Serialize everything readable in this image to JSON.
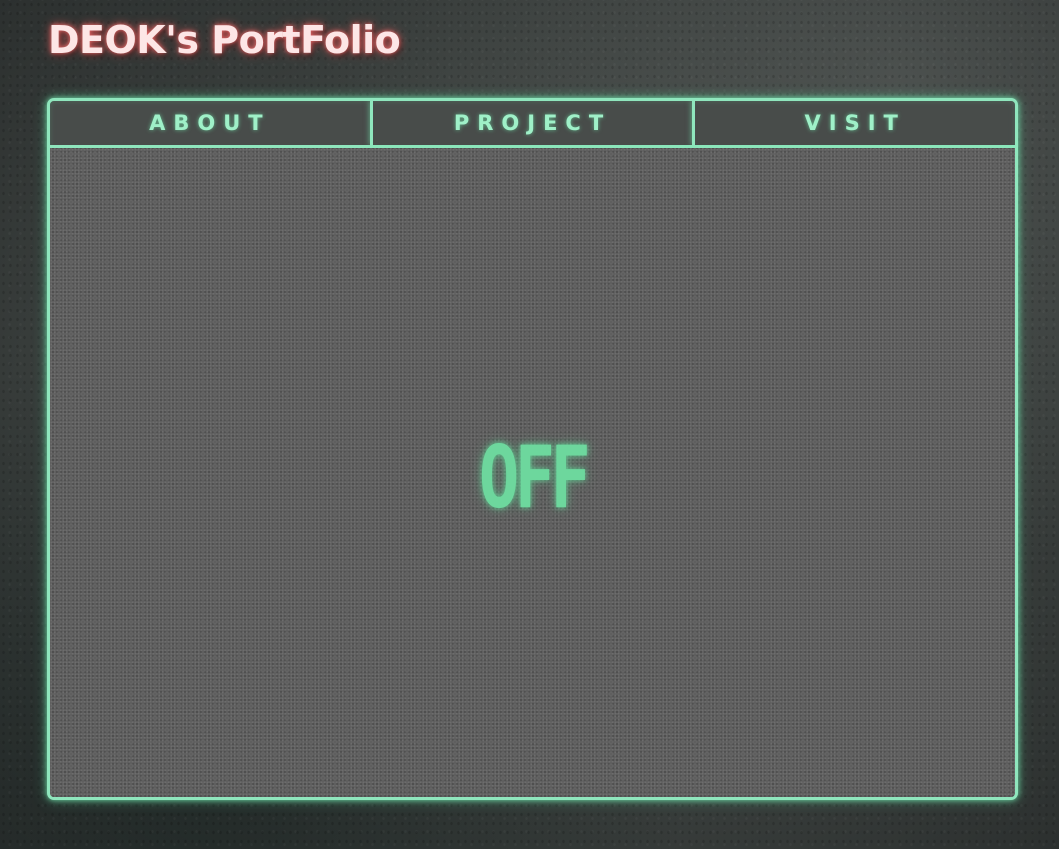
{
  "header": {
    "title": "DEOK's PortFolio"
  },
  "nav": {
    "tabs": [
      {
        "label": "ABOUT"
      },
      {
        "label": "PROJECT"
      },
      {
        "label": "VISIT"
      }
    ]
  },
  "screen": {
    "status": "OFF"
  },
  "colors": {
    "accent_glow": "#8fe6bd",
    "status_text": "#6dd79d",
    "title_glow": "#ff7a7a"
  }
}
